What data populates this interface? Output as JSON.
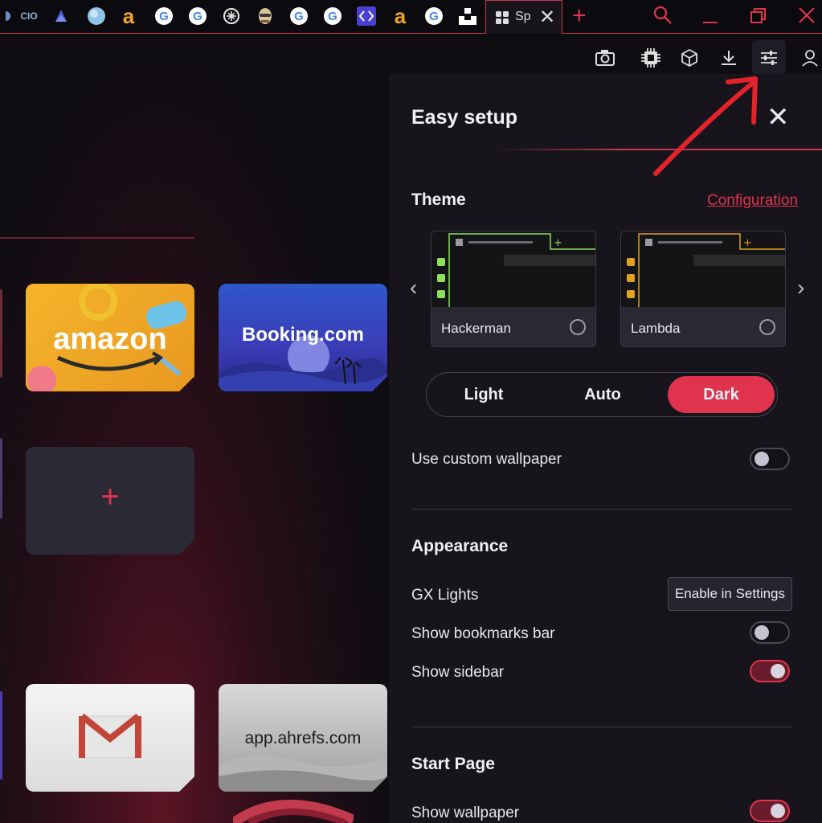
{
  "tabs": {
    "cio_label": "CIO",
    "amazon_glyph": "a",
    "google_glyph": "G",
    "active_title": "Sp",
    "active_close": "✕",
    "new_tab": "+",
    "icons": [
      "search-icon",
      "minimize-icon",
      "restore-icon",
      "close-icon"
    ]
  },
  "toolbar": {
    "icons": [
      "camera-icon",
      "ai-chip-icon",
      "cube-icon",
      "download-icon",
      "easy-setup-icon",
      "profile-icon"
    ]
  },
  "speed_dial": {
    "tiles": [
      {
        "id": "amazon",
        "label": "amazon"
      },
      {
        "id": "booking",
        "label": "Booking.com"
      },
      {
        "id": "add",
        "label": "+"
      },
      {
        "id": "gmail",
        "label": "M"
      },
      {
        "id": "ahrefs",
        "label": "app.ahrefs.com"
      }
    ]
  },
  "panel": {
    "title": "Easy setup",
    "close": "✕",
    "theme": {
      "title": "Theme",
      "config_link": "Configuration",
      "prev": "‹",
      "next": "›",
      "cards": [
        {
          "name": "Hackerman",
          "accent": "#8de05a"
        },
        {
          "name": "Lambda",
          "accent": "#e0a020"
        }
      ],
      "modes": [
        "Light",
        "Auto",
        "Dark"
      ],
      "selected_mode": "Dark"
    },
    "custom_wallpaper": {
      "label": "Use custom wallpaper",
      "enabled": false
    },
    "appearance": {
      "title": "Appearance",
      "gx_lights": {
        "label": "GX Lights",
        "button": "Enable in Settings"
      },
      "bookmarks_bar": {
        "label": "Show bookmarks bar",
        "enabled": false
      },
      "sidebar": {
        "label": "Show sidebar",
        "enabled": true
      }
    },
    "start_page": {
      "title": "Start Page",
      "show_wallpaper": {
        "label": "Show wallpaper",
        "enabled": true
      }
    }
  },
  "colors": {
    "accent": "#e0334e",
    "panel_bg": "#17151b",
    "page_bg": "#0f0d12"
  }
}
